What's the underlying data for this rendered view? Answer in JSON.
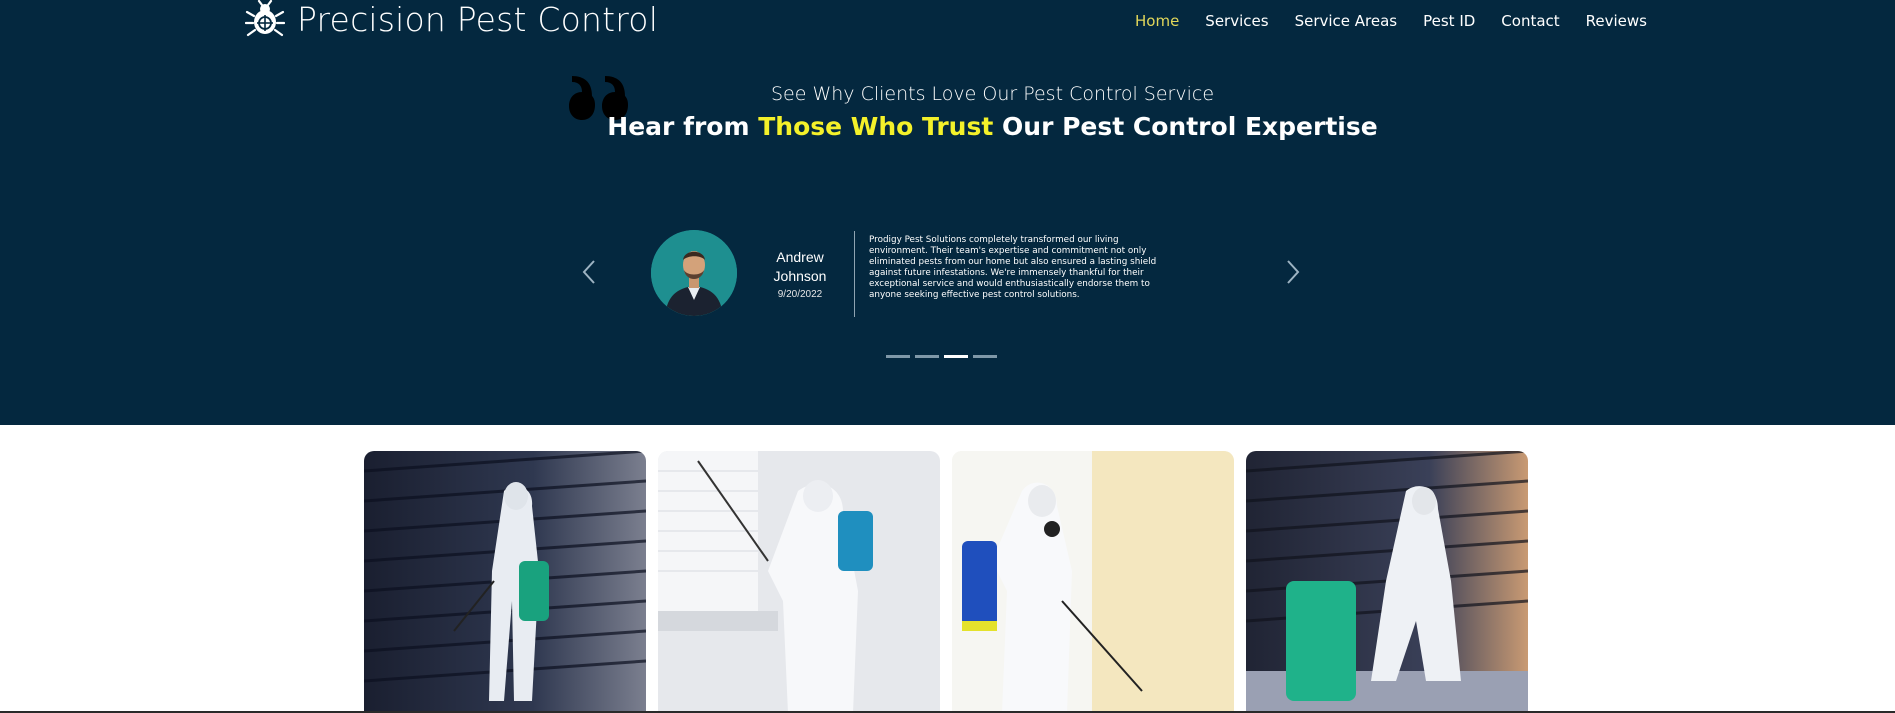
{
  "header": {
    "brand_name": "Precision Pest Control",
    "brand_icon": "bug-crosshair-icon",
    "nav": [
      "Home",
      "Services",
      "Service Areas",
      "Pest ID",
      "Contact",
      "Reviews"
    ],
    "active_nav": "Home"
  },
  "testimonials": {
    "subheading": "See Why Clients Love Our Pest Control Service",
    "heading_start": "Hear from ",
    "heading_highlight": "Those Who Trust",
    "heading_end": " Our Pest Control Expertise",
    "current": {
      "name_first": "Andrew",
      "name_last": "Johnson",
      "date": "9/20/2022",
      "text": "Prodigy Pest Solutions completely transformed our living environment. Their team's expertise and commitment not only eliminated pests from our home but also ensured a lasting shield against future infestations. We're immensely thankful for their exceptional service and would enthusiastically endorse them to anyone seeking effective pest control solutions."
    },
    "slide_count": 4,
    "active_slide": 3
  },
  "colors": {
    "hero_bg": "#04283f",
    "nav_active": "#e2d75a",
    "heading_highlight": "#f4f12a",
    "avatar_bg": "#1e8f90"
  },
  "gallery": [
    {
      "subject": "technician spraying near shutters"
    },
    {
      "subject": "technician spraying window sill"
    },
    {
      "subject": "technician spraying wall"
    },
    {
      "subject": "technician kneeling thumbs up"
    }
  ]
}
